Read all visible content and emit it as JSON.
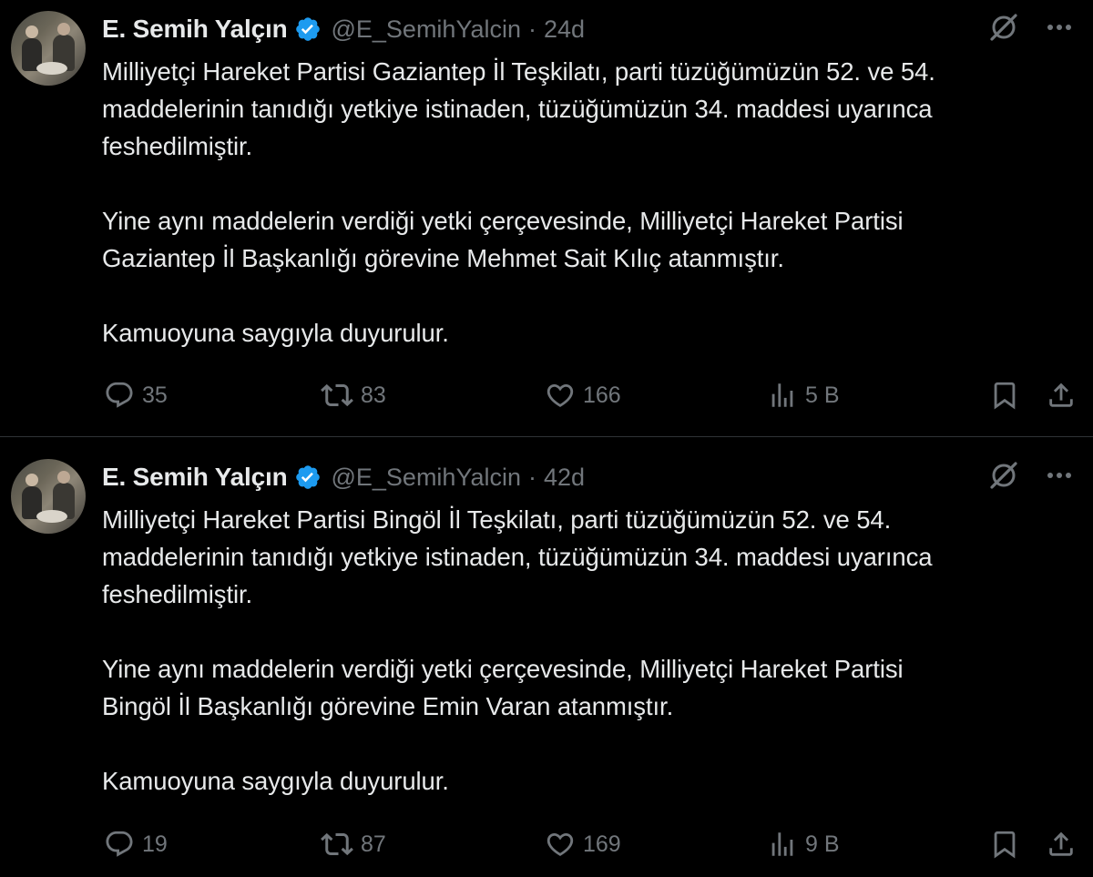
{
  "tweets": [
    {
      "author_name": "E. Semih Yalçın",
      "handle": "@E_SemihYalcin",
      "separator": "·",
      "time": "24d",
      "paragraphs": [
        "Milliyetçi Hareket Partisi Gaziantep İl Teşkilatı, parti tüzüğümüzün 52. ve 54.\nmaddelerinin tanıdığı yetkiye istinaden, tüzüğümüzün 34. maddesi uyarınca\nfeshedilmiştir.",
        "Yine aynı maddelerin verdiği yetki çerçevesinde, Milliyetçi Hareket Partisi\nGaziantep İl Başkanlığı görevine Mehmet Sait Kılıç atanmıştır.",
        "Kamuoyuna saygıyla duyurulur."
      ],
      "replies": "35",
      "retweets": "83",
      "likes": "166",
      "views": "5 B"
    },
    {
      "author_name": "E. Semih Yalçın",
      "handle": "@E_SemihYalcin",
      "separator": "·",
      "time": "42d",
      "paragraphs": [
        "Milliyetçi Hareket Partisi Bingöl İl Teşkilatı, parti tüzüğümüzün 52. ve 54.\nmaddelerinin tanıdığı yetkiye istinaden, tüzüğümüzün 34. maddesi uyarınca\nfeshedilmiştir.",
        "Yine aynı maddelerin verdiği yetki çerçevesinde, Milliyetçi Hareket Partisi\nBingöl İl Başkanlığı görevine Emin Varan atanmıştır.",
        "Kamuoyuna saygıyla duyurulur."
      ],
      "replies": "19",
      "retweets": "87",
      "likes": "169",
      "views": "9 B"
    }
  ],
  "icons": {
    "verified": "verified-badge-icon",
    "grok": "grok-icon",
    "more": "more-icon",
    "reply": "reply-icon",
    "retweet": "retweet-icon",
    "like": "heart-icon",
    "views": "views-icon",
    "bookmark": "bookmark-icon",
    "share": "share-icon"
  },
  "colors": {
    "background": "#000000",
    "text": "#e7e9ea",
    "secondary": "#71767b",
    "verified": "#1d9bf0",
    "divider": "#2f3336"
  }
}
